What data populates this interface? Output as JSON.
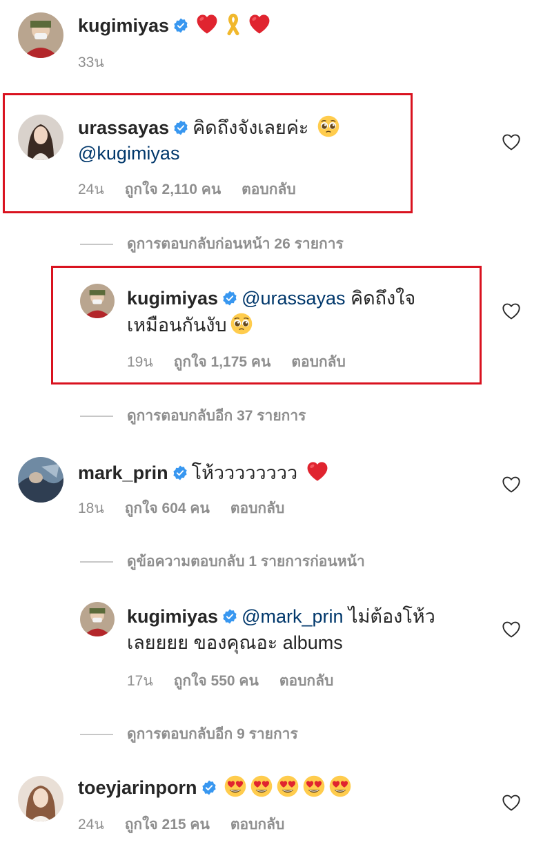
{
  "comments": [
    {
      "username": "kugimiyas",
      "text": "",
      "emojis": [
        "red-heart",
        "yellow-ribbon",
        "red-heart"
      ],
      "time": "33น"
    },
    {
      "username": "urassayas",
      "text": "คิดถึงจังเลยค่ะ",
      "mention": "@kugimiyas",
      "emojis": [
        "pleading-face"
      ],
      "time": "24น",
      "likes": "ถูกใจ 2,110 คน",
      "reply": "ตอบกลับ"
    },
    {
      "username": "kugimiyas",
      "mention": "@urassayas",
      "text": "คิดถึงใจ",
      "text2": "เหมือนกันงับ",
      "emojis": [
        "pleading-face"
      ],
      "time": "19น",
      "likes": "ถูกใจ 1,175 คน",
      "reply": "ตอบกลับ"
    },
    {
      "username": "mark_prin",
      "text": "โห้วววววววว",
      "emojis": [
        "red-heart"
      ],
      "time": "18น",
      "likes": "ถูกใจ 604 คน",
      "reply": "ตอบกลับ"
    },
    {
      "username": "kugimiyas",
      "mention": "@mark_prin",
      "text": "ไม่ต้องโห้ว",
      "text2": "เลยยยย ของคุณอะ albums",
      "time": "17น",
      "likes": "ถูกใจ 550 คน",
      "reply": "ตอบกลับ"
    },
    {
      "username": "toeyjarinporn",
      "text": "",
      "emojis": [
        "heart-eyes",
        "heart-eyes",
        "heart-eyes",
        "heart-eyes",
        "heart-eyes"
      ],
      "time": "24น",
      "likes": "ถูกใจ 215 คน",
      "reply": "ตอบกลับ"
    }
  ],
  "view_replies": [
    "ดูการตอบกลับก่อนหน้า 26 รายการ",
    "ดูการตอบกลับอีก 37 รายการ",
    "ดูข้อความตอบกลับ 1 รายการก่อนหน้า",
    "ดูการตอบกลับอีก 9 รายการ"
  ],
  "colors": {
    "highlight": "#d9121f",
    "verified": "#3897f0",
    "mention": "#00376b",
    "meta": "#8e8e8e"
  }
}
